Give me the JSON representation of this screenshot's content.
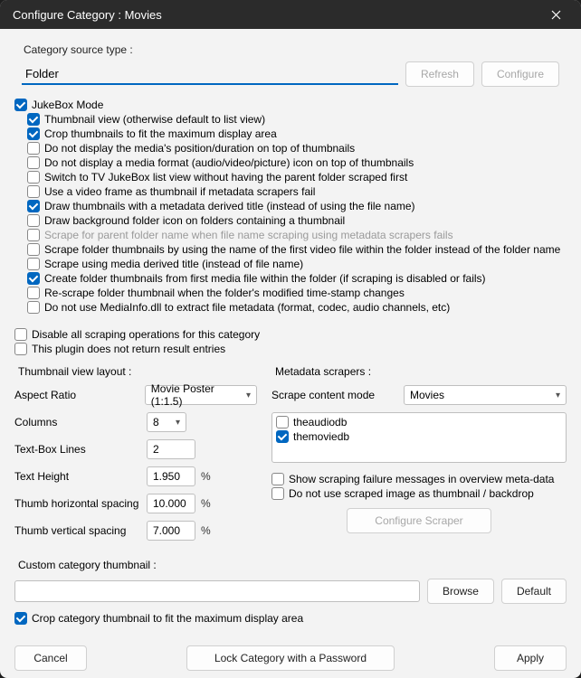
{
  "window_title": "Configure Category : Movies",
  "source": {
    "label": "Category source type :",
    "value": "Folder",
    "refresh_label": "Refresh",
    "configure_label": "Configure"
  },
  "checks_main": [
    {
      "label": "JukeBox Mode",
      "checked": true,
      "indent": false,
      "disabled": false
    },
    {
      "label": "Thumbnail view (otherwise default to list view)",
      "checked": true,
      "indent": true,
      "disabled": false
    },
    {
      "label": "Crop thumbnails to fit the maximum display area",
      "checked": true,
      "indent": true,
      "disabled": false
    },
    {
      "label": "Do not display the media's position/duration on top of thumbnails",
      "checked": false,
      "indent": true,
      "disabled": false
    },
    {
      "label": "Do not display a media format (audio/video/picture) icon on top of thumbnails",
      "checked": false,
      "indent": true,
      "disabled": false
    },
    {
      "label": "Switch to TV JukeBox list view without having the parent folder scraped first",
      "checked": false,
      "indent": true,
      "disabled": false
    },
    {
      "label": "Use a video frame as thumbnail if metadata scrapers fail",
      "checked": false,
      "indent": true,
      "disabled": false
    },
    {
      "label": "Draw thumbnails with a metadata derived title (instead of using the file name)",
      "checked": true,
      "indent": true,
      "disabled": false
    },
    {
      "label": "Draw background folder icon on folders containing a thumbnail",
      "checked": false,
      "indent": true,
      "disabled": false
    },
    {
      "label": "Scrape for parent folder name when file name scraping using metadata scrapers fails",
      "checked": false,
      "indent": true,
      "disabled": true
    },
    {
      "label": "Scrape folder thumbnails by using the name of the first video file within the folder instead of the folder name",
      "checked": false,
      "indent": true,
      "disabled": false
    },
    {
      "label": "Scrape using media derived title (instead of file name)",
      "checked": false,
      "indent": true,
      "disabled": false
    },
    {
      "label": "Create folder thumbnails from first media file within the folder (if scraping is disabled or fails)",
      "checked": true,
      "indent": true,
      "disabled": false
    },
    {
      "label": "Re-scrape folder thumbnail when the folder's modified time-stamp changes",
      "checked": false,
      "indent": true,
      "disabled": false
    },
    {
      "label": "Do not use MediaInfo.dll to extract file metadata (format, codec, audio channels, etc)",
      "checked": false,
      "indent": true,
      "disabled": false
    }
  ],
  "checks_secondary": [
    {
      "label": "Disable all scraping operations for this category",
      "checked": false
    },
    {
      "label": "This plugin does not return result entries",
      "checked": false
    }
  ],
  "thumb_layout": {
    "group_label": "Thumbnail view layout :",
    "aspect_label": "Aspect Ratio",
    "aspect_value": "Movie Poster (1:1.5)",
    "columns_label": "Columns",
    "columns_value": "8",
    "textbox_label": "Text-Box Lines",
    "textbox_value": "2",
    "textheight_label": "Text Height",
    "textheight_value": "1.950",
    "hspacing_label": "Thumb horizontal spacing",
    "hspacing_value": "10.000",
    "vspacing_label": "Thumb vertical spacing",
    "vspacing_value": "7.000",
    "pct": "%"
  },
  "scrapers": {
    "group_label": "Metadata scrapers :",
    "mode_label": "Scrape content mode",
    "mode_value": "Movies",
    "items": [
      {
        "label": "theaudiodb",
        "checked": false
      },
      {
        "label": "themoviedb",
        "checked": true
      }
    ],
    "show_failure_label": "Show scraping failure messages in overview meta-data",
    "show_failure_checked": false,
    "no_backdrop_label": "Do not use scraped image as thumbnail / backdrop",
    "no_backdrop_checked": false,
    "configure_scraper_label": "Configure Scraper"
  },
  "custom": {
    "group_label": "Custom category thumbnail :",
    "path_value": "",
    "browse_label": "Browse",
    "default_label": "Default",
    "crop_label": "Crop category thumbnail to fit the maximum display area",
    "crop_checked": true
  },
  "footer": {
    "cancel_label": "Cancel",
    "lock_label": "Lock Category with a Password",
    "apply_label": "Apply"
  }
}
